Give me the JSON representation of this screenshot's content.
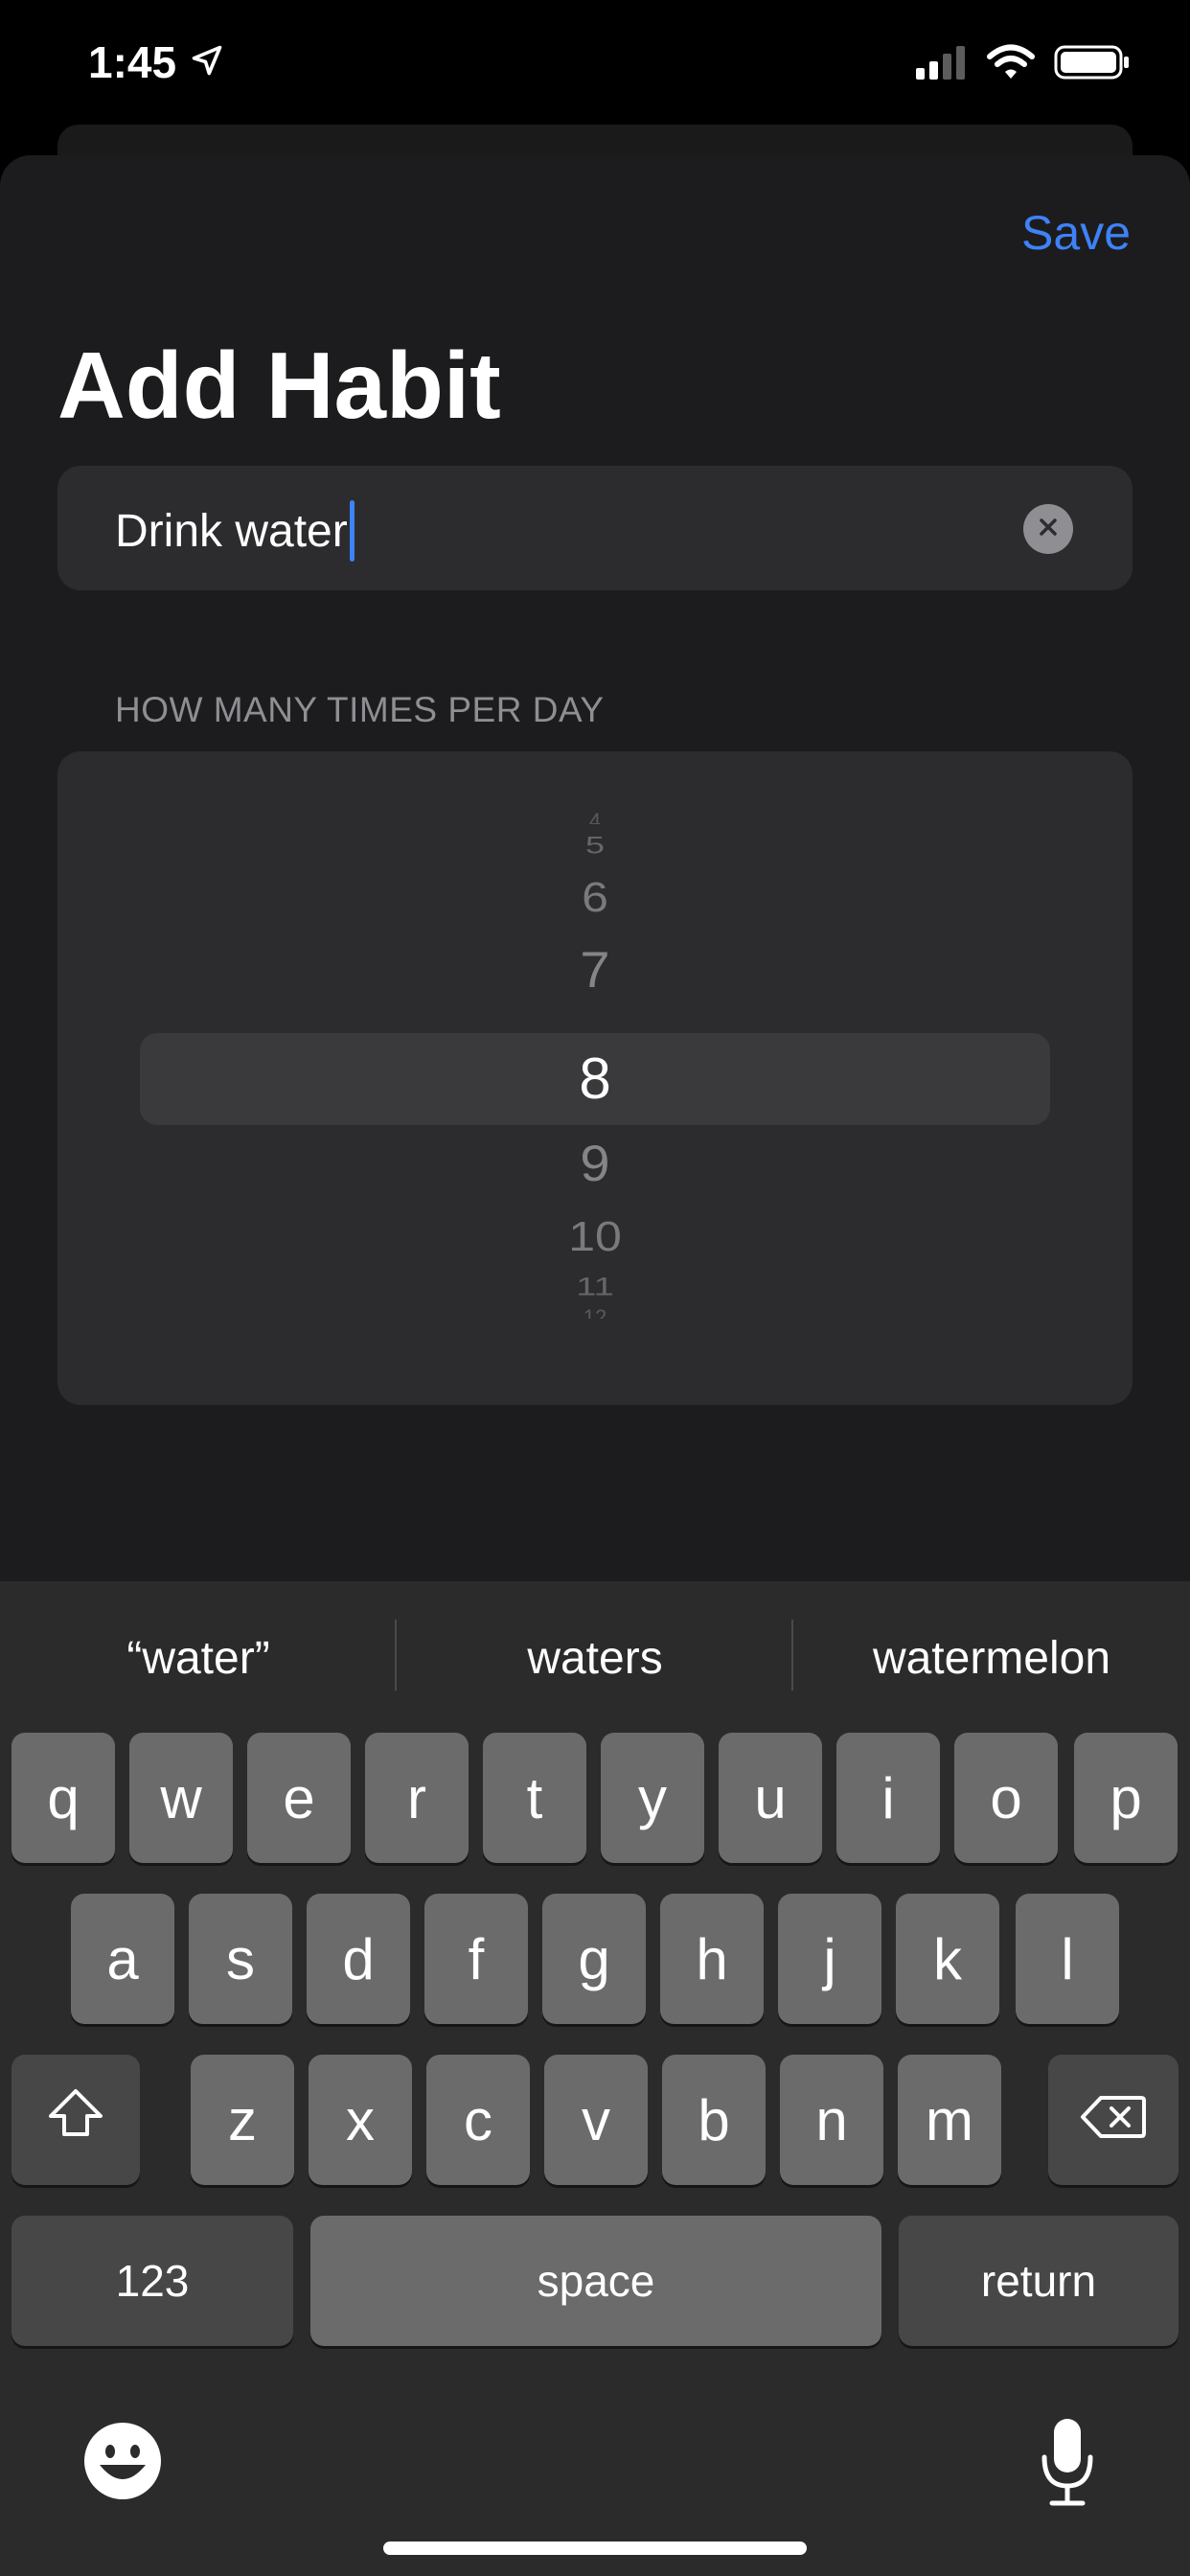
{
  "status": {
    "time": "1:45"
  },
  "header": {
    "save_label": "Save",
    "title": "Add Habit"
  },
  "name_field": {
    "value": "Drink water"
  },
  "times_section": {
    "label": "HOW MANY TIMES PER DAY",
    "picker_items": [
      "4",
      "5",
      "6",
      "7",
      "8",
      "9",
      "10",
      "11",
      "12"
    ],
    "selected": "8"
  },
  "suggestions": [
    "“water”",
    "waters",
    "watermelon"
  ],
  "keyboard": {
    "row1": [
      "q",
      "w",
      "e",
      "r",
      "t",
      "y",
      "u",
      "i",
      "o",
      "p"
    ],
    "row2": [
      "a",
      "s",
      "d",
      "f",
      "g",
      "h",
      "j",
      "k",
      "l"
    ],
    "row3": [
      "z",
      "x",
      "c",
      "v",
      "b",
      "n",
      "m"
    ],
    "numbers_label": "123",
    "space_label": "space",
    "return_label": "return"
  },
  "colors": {
    "accent": "#3e82f7",
    "background": "#1c1c1e",
    "field": "#2c2c2e"
  }
}
